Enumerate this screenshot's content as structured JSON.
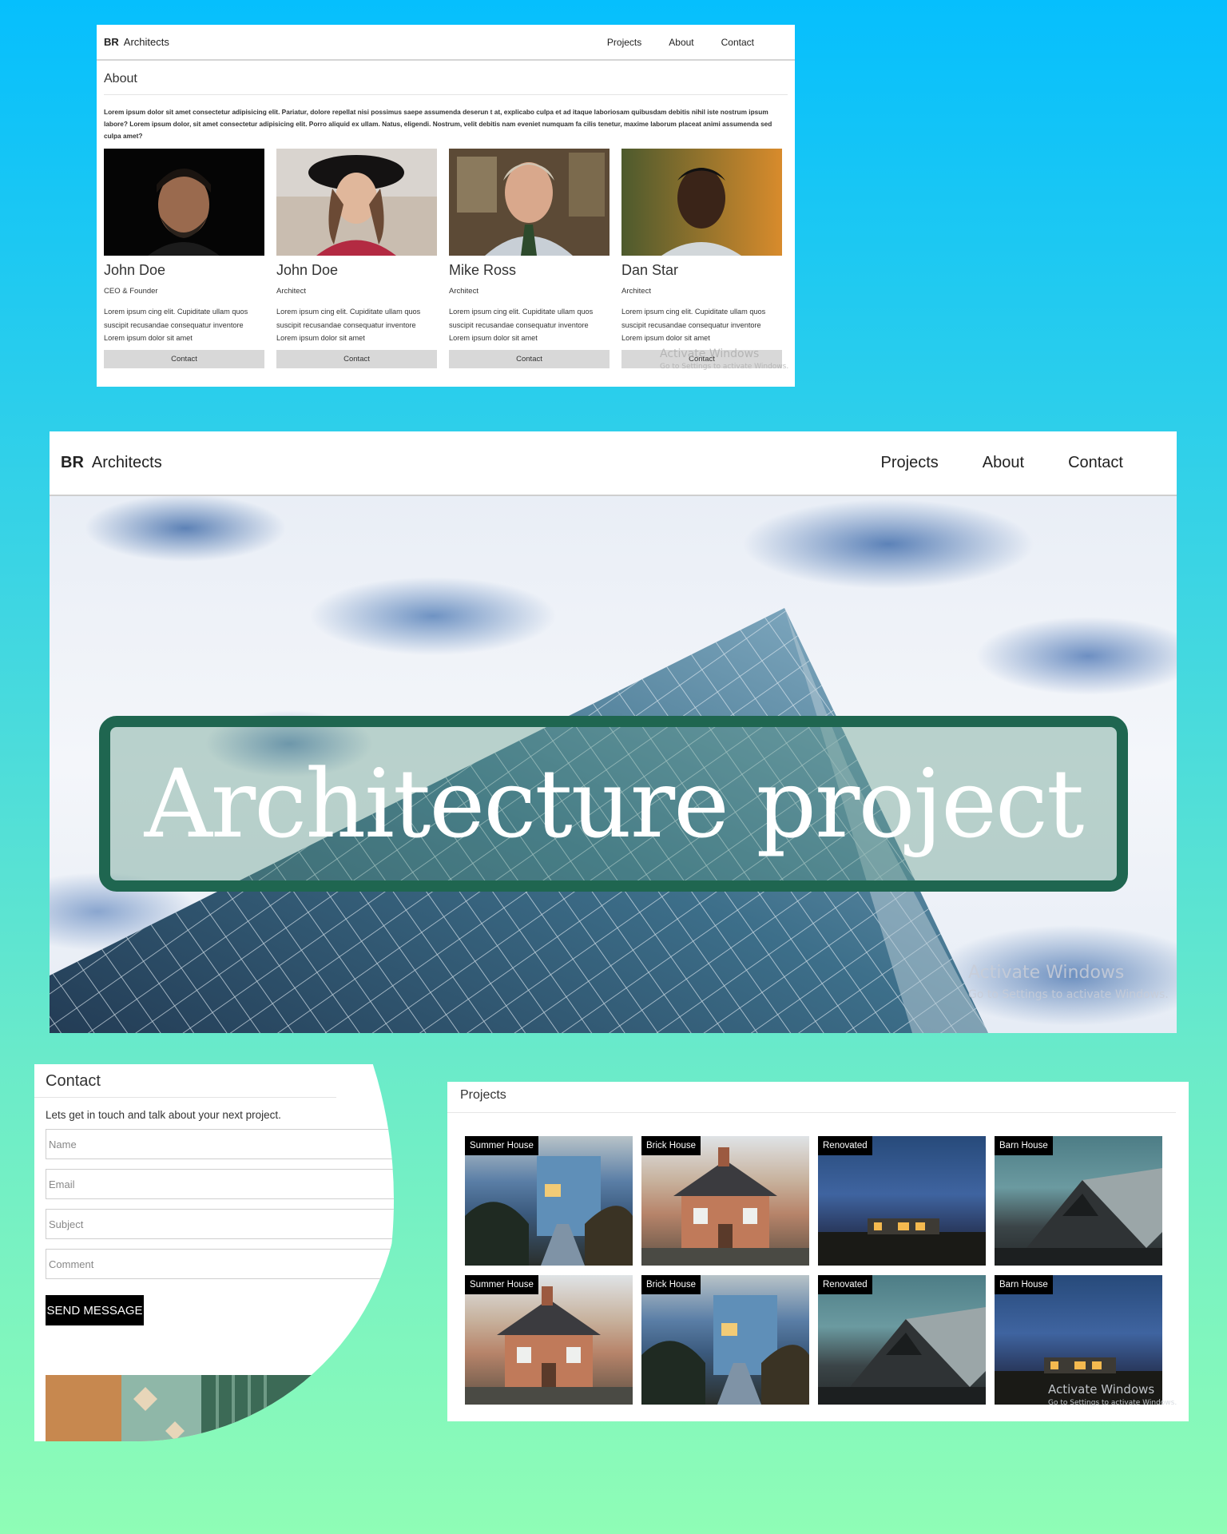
{
  "about_page": {
    "brand": "BR",
    "brand_suffix": "Architects",
    "nav": [
      "Projects",
      "About",
      "Contact"
    ],
    "section_title": "About",
    "intro": "Lorem ipsum dolor sit amet consectetur adipisicing elit. Pariatur, dolore repellat nisi possimus saepe assumenda deserun t at, explicabo culpa et ad itaque laboriosam quibusdam debitis nihil iste nostrum ipsum labore? Lorem ipsum dolor, sit amet consectetur adipisicing elit. Porro aliquid ex ullam. Natus, eligendi. Nostrum, velit debitis nam eveniet numquam fa cilis tenetur, maxime laborum placeat animi assumenda sed culpa amet?",
    "members": [
      {
        "name": "John Doe",
        "role": "CEO & Founder",
        "desc": "Lorem ipsum cing elit. Cupiditate ullam quos suscipit recusandae consequatur inventore Lorem ipsum dolor sit amet",
        "button": "Contact"
      },
      {
        "name": "John Doe",
        "role": "Architect",
        "desc": "Lorem ipsum cing elit. Cupiditate ullam quos suscipit recusandae consequatur inventore Lorem ipsum dolor sit amet",
        "button": "Contact"
      },
      {
        "name": "Mike Ross",
        "role": "Architect",
        "desc": "Lorem ipsum cing elit. Cupiditate ullam quos suscipit recusandae consequatur inventore Lorem ipsum dolor sit amet",
        "button": "Contact"
      },
      {
        "name": "Dan Star",
        "role": "Architect",
        "desc": "Lorem ipsum cing elit. Cupiditate ullam quos suscipit recusandae consequatur inventore Lorem ipsum dolor sit amet",
        "button": "Contact"
      }
    ],
    "watermark_title": "Activate Windows",
    "watermark_sub": "Go to Settings to activate Windows."
  },
  "hero_page": {
    "brand": "BR",
    "brand_suffix": "Architects",
    "nav": [
      "Projects",
      "About",
      "Contact"
    ],
    "banner": "Architecture project",
    "watermark_title": "Activate Windows",
    "watermark_sub": "Go to Settings to activate Windows."
  },
  "contact_page": {
    "title": "Contact",
    "lead": "Lets get in touch and talk about your next project.",
    "placeholders": {
      "name": "Name",
      "email": "Email",
      "subject": "Subject",
      "comment": "Comment"
    },
    "send": "SEND MESSAGE"
  },
  "projects_page": {
    "title": "Projects",
    "tiles": [
      {
        "label": "Summer House",
        "image": "summer-house-photo"
      },
      {
        "label": "Brick House",
        "image": "brick-house-photo"
      },
      {
        "label": "Renovated",
        "image": "renovated-house-photo"
      },
      {
        "label": "Barn House",
        "image": "barn-house-photo"
      },
      {
        "label": "Summer House",
        "image": "brick-house-photo"
      },
      {
        "label": "Brick House",
        "image": "summer-house-photo"
      },
      {
        "label": "Renovated",
        "image": "barn-house-photo"
      },
      {
        "label": "Barn House",
        "image": "renovated-house-photo"
      }
    ],
    "watermark_title": "Activate Windows",
    "watermark_sub": "Go to Settings to activate Windows."
  },
  "colors": {
    "background_top": "#06bffd",
    "background_bottom": "#8ffdb6",
    "banner_border": "#1f6650",
    "button_grey": "#d8d8d8",
    "send_button": "#000000"
  }
}
